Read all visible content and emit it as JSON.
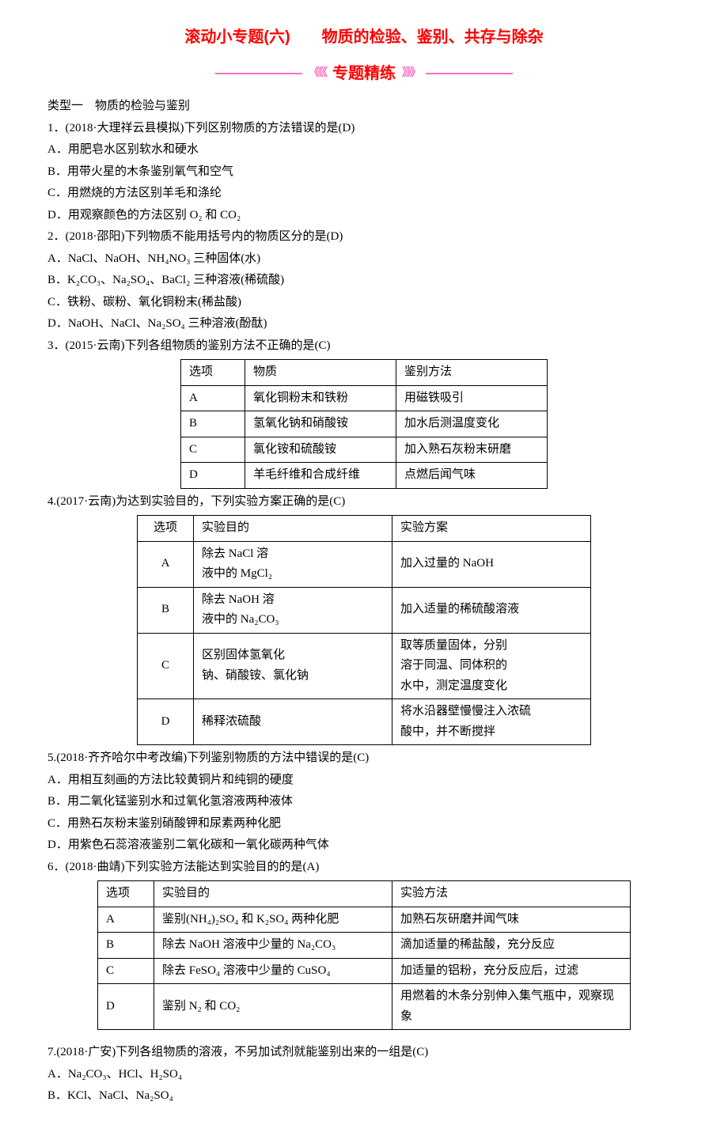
{
  "title": "滚动小专题(六)　　物质的检验、鉴别、共存与除杂",
  "banner": {
    "arrows_l": "《《《",
    "label": "专题精练",
    "arrows_r": "》》》"
  },
  "category1": "类型一　物质的检验与鉴别",
  "q1": {
    "stem": "1．(2018·大理祥云县模拟)下列区别物质的方法错误的是(D)",
    "a": "A．用肥皂水区别软水和硬水",
    "b": "B．用带火星的木条鉴别氧气和空气",
    "c": "C．用燃烧的方法区别羊毛和涤纶",
    "d": "D．用观察颜色的方法区别 O₂ 和 CO₂"
  },
  "q2": {
    "stem": "2．(2018·邵阳)下列物质不能用括号内的物质区分的是(D)",
    "a": "A．NaCl、NaOH、NH₄NO₃ 三种固体(水)",
    "b": "B．K₂CO₃、Na₂SO₄、BaCl₂ 三种溶液(稀硫酸)",
    "c": "C．铁粉、碳粉、氧化铜粉末(稀盐酸)",
    "d": "D．NaOH、NaCl、Na₂SO₄ 三种溶液(酚酞)"
  },
  "q3": {
    "stem": "3．(2015·云南)下列各组物质的鉴别方法不正确的是(C)",
    "headers": [
      "选项",
      "物质",
      "鉴别方法"
    ],
    "rows": [
      [
        "A",
        "氧化铜粉末和铁粉",
        "用磁铁吸引"
      ],
      [
        "B",
        "氢氧化钠和硝酸铵",
        "加水后测温度变化"
      ],
      [
        "C",
        "氯化铵和硫酸铵",
        "加入熟石灰粉末研磨"
      ],
      [
        "D",
        "羊毛纤维和合成纤维",
        "点燃后闻气味"
      ]
    ]
  },
  "q4": {
    "stem": "4.(2017·云南)为达到实验目的，下列实验方案正确的是(C)",
    "headers": [
      "选项",
      "实验目的",
      "实验方案"
    ],
    "rows": [
      [
        "A",
        "除去 NaCl 溶\n液中的 MgCl₂",
        "加入过量的 NaOH"
      ],
      [
        "B",
        "除去 NaOH 溶\n液中的 Na₂CO₃",
        "加入适量的稀硫酸溶液"
      ],
      [
        "C",
        "区别固体氢氧化\n钠、硝酸铵、氯化钠",
        "取等质量固体，分别\n溶于同温、同体积的\n水中，测定温度变化"
      ],
      [
        "D",
        "稀释浓硫酸",
        "将水沿器壁慢慢注入浓硫\n酸中，并不断搅拌"
      ]
    ]
  },
  "q5": {
    "stem": "5.(2018·齐齐哈尔中考改编)下列鉴别物质的方法中错误的是(C)",
    "a": "A．用相互刻画的方法比较黄铜片和纯铜的硬度",
    "b": "B．用二氧化锰鉴别水和过氧化氢溶液两种液体",
    "c": "C．用熟石灰粉末鉴别硝酸钾和尿素两种化肥",
    "d": "D．用紫色石蕊溶液鉴别二氧化碳和一氧化碳两种气体"
  },
  "q6": {
    "stem": "6．(2018·曲靖)下列实验方法能达到实验目的的是(A)",
    "headers": [
      "选项",
      "实验目的",
      "实验方法"
    ],
    "rows": [
      [
        "A",
        "鉴别(NH₄)₂SO₄ 和 K₂SO₄ 两种化肥",
        "加熟石灰研磨并闻气味"
      ],
      [
        "B",
        "除去 NaOH 溶液中少量的 Na₂CO₃",
        "滴加适量的稀盐酸，充分反应"
      ],
      [
        "C",
        "除去 FeSO₄ 溶液中少量的 CuSO₄",
        "加适量的铝粉，充分反应后，过滤"
      ],
      [
        "D",
        "鉴别 N₂ 和 CO₂",
        "用燃着的木条分别伸入集气瓶中，观察现\n象"
      ]
    ]
  },
  "q7": {
    "stem": "7.(2018·广安)下列各组物质的溶液，不另加试剂就能鉴别出来的一组是(C)",
    "a": "A．Na₂CO₃、HCl、H₂SO₄",
    "b": "B．KCl、NaCl、Na₂SO₄"
  }
}
